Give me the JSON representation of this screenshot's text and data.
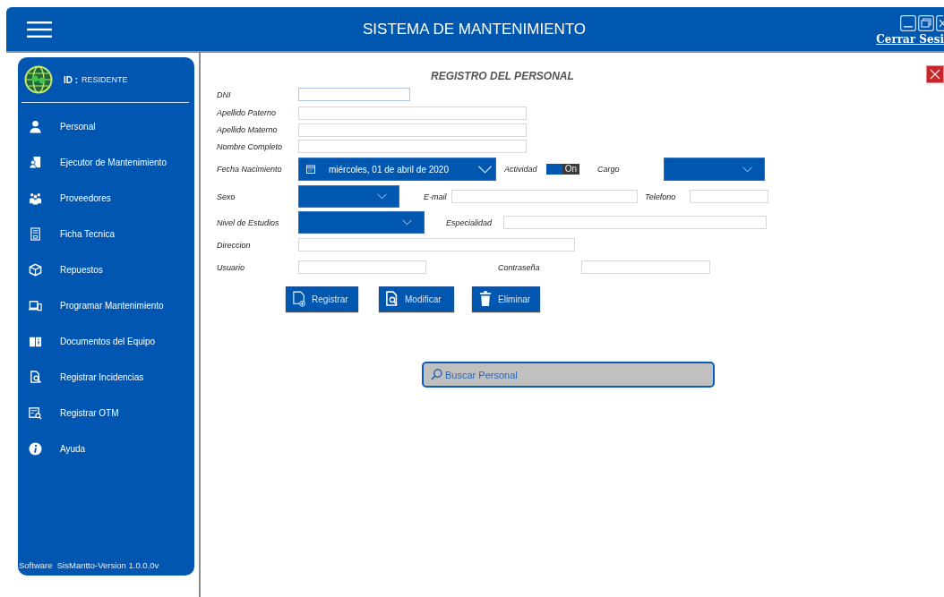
{
  "header": {
    "title": "SISTEMA DE MANTENIMIENTO",
    "logout_link": "Cerrar Sesi"
  },
  "sidebar": {
    "id_label": "ID :",
    "id_value": "RESIDENTE",
    "items": [
      {
        "label": "Personal"
      },
      {
        "label": "Ejecutor de Mantenimiento"
      },
      {
        "label": "Proveedores"
      },
      {
        "label": "Ficha Tecnica"
      },
      {
        "label": "Repuestos"
      },
      {
        "label": "Programar Mantenimiento"
      },
      {
        "label": "Documentos del Equipo"
      },
      {
        "label": "Registrar Incidencias"
      },
      {
        "label": "Registrar OTM"
      },
      {
        "label": "Ayuda"
      }
    ],
    "footer": "Software  SisMantto-Version 1.0.0.0v"
  },
  "form": {
    "title": "REGISTRO DEL PERSONAL",
    "fields": [
      {
        "label": "DNI",
        "kind": "text",
        "focused": true
      },
      {
        "label": "Apellido Paterno",
        "kind": "text",
        "focused": false
      },
      {
        "label": "Apellido Materno",
        "kind": "text",
        "focused": false
      },
      {
        "label": "Nombre Completo",
        "kind": "text",
        "focused": false
      },
      {
        "label": "Fecha Nacimiento",
        "kind": "date",
        "value": "miércoles, 01 de abril de 2020"
      },
      {
        "label": "Actividad",
        "kind": "toggle",
        "toggle_text": "On",
        "on": true
      },
      {
        "label": "Cargo",
        "kind": "select"
      },
      {
        "label": "Sexo",
        "kind": "select"
      },
      {
        "label": "E-mail",
        "kind": "text",
        "focused": false
      },
      {
        "label": "Telefono",
        "kind": "text",
        "focused": false
      },
      {
        "label": "Nivel de Estudios",
        "kind": "select"
      },
      {
        "label": "Especialidad",
        "kind": "text",
        "focused": false
      },
      {
        "label": "Direccion",
        "kind": "text",
        "focused": false
      },
      {
        "label": "Usuario",
        "kind": "text",
        "focused": false
      },
      {
        "label": "Contraseña",
        "kind": "text",
        "focused": false
      }
    ],
    "buttons": [
      {
        "label": "Registrar"
      },
      {
        "label": "Modificar"
      },
      {
        "label": "Eliminar"
      }
    ]
  },
  "search": {
    "placeholder": "Buscar Personal"
  }
}
